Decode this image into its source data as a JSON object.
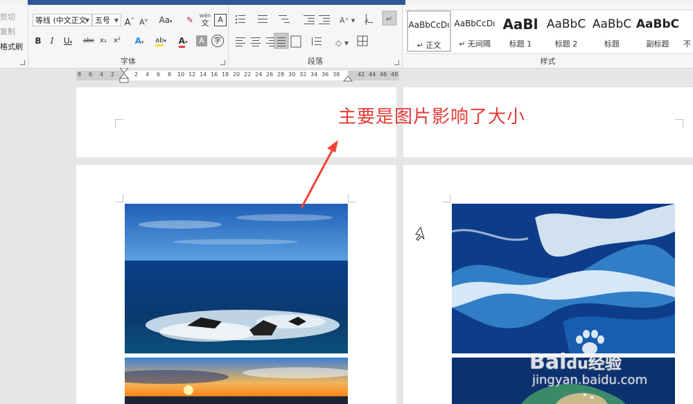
{
  "clipboard": {
    "cut": "剪切",
    "copy": "复制",
    "format_painter": "格式刷"
  },
  "font": {
    "group_label": "字体",
    "font_name": "等线 (中文正文",
    "font_size": "五号",
    "grow_font": "A",
    "shrink_font": "A",
    "change_case": "Aa",
    "pinyin_top": "wén",
    "pinyin_bottom": "文",
    "char_border": "A",
    "bold": "B",
    "italic": "I",
    "underline": "U",
    "strikethrough": "abc",
    "subscript": "x₂",
    "superscript": "x²",
    "text_effects": "A",
    "highlight": "ab",
    "font_color": "A",
    "char_shading": "A",
    "enclose_char": "字"
  },
  "paragraph": {
    "group_label": "段落"
  },
  "styles": {
    "group_label": "样式",
    "items": [
      {
        "sample": "AaBbCcDı",
        "name": "正文",
        "active": true
      },
      {
        "sample": "AaBbCcDı",
        "name": "无间隔",
        "active": false
      },
      {
        "sample": "AaBl",
        "name": "标题 1",
        "active": false
      },
      {
        "sample": "AaBbC",
        "name": "标题 2",
        "active": false
      },
      {
        "sample": "AaBbC",
        "name": "标题",
        "active": false
      },
      {
        "sample": "AaBbC",
        "name": "副标题",
        "active": false
      },
      {
        "sample": "",
        "name": "不",
        "active": false
      }
    ]
  },
  "ruler": {
    "left_numbers": [
      "8",
      "6",
      "4",
      "2"
    ],
    "right_numbers": [
      "2",
      "4",
      "6",
      "8",
      "10",
      "12",
      "14",
      "16",
      "18",
      "20",
      "22",
      "24",
      "26",
      "28",
      "30",
      "32",
      "34",
      "36",
      "38"
    ],
    "trailing_numbers": [
      "42",
      "44",
      "46",
      "48"
    ]
  },
  "annotation": {
    "text": "主要是图片影响了大小",
    "color": "#e53935"
  },
  "watermark": {
    "brand": "Bai",
    "brand_suffix": "经验",
    "url": "jingyan.baidu.com"
  }
}
